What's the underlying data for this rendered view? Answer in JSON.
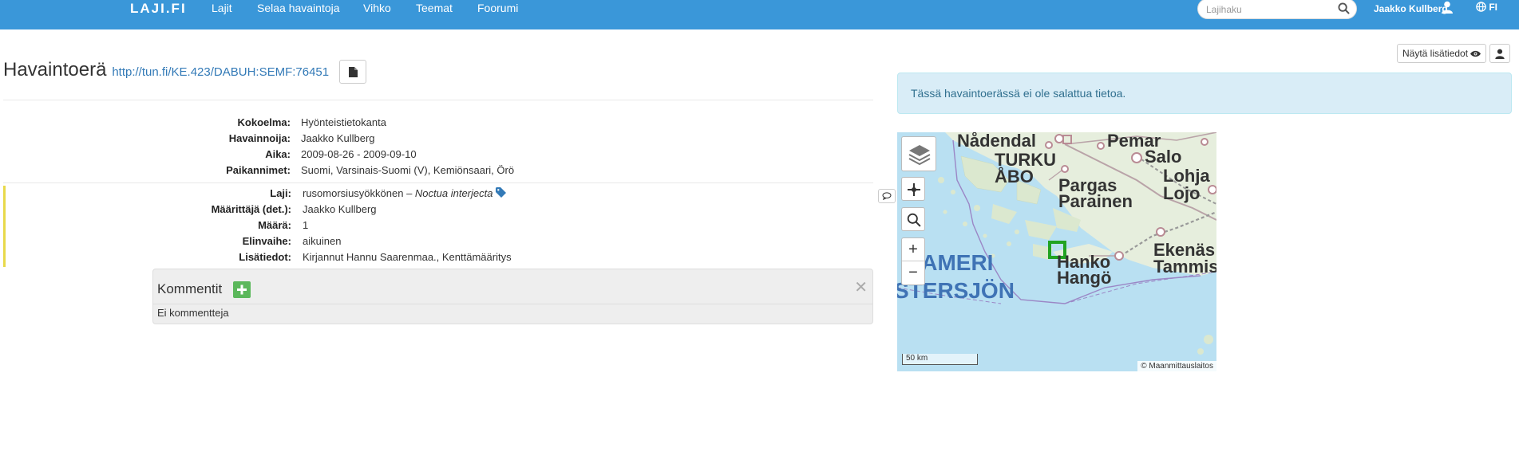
{
  "nav": {
    "brand": "LAJI.FI",
    "links": [
      "Lajit",
      "Selaa havaintoja",
      "Vihko",
      "Teemat",
      "Foorumi"
    ],
    "search_placeholder": "Lajihaku",
    "user": "Jaakko Kullberg",
    "lang": "FI"
  },
  "toolbar": {
    "details_label": "Näytä lisätiedot"
  },
  "page": {
    "title": "Havaintoerä",
    "uri": "http://tun.fi/KE.423/DABUH:SEMF:76451"
  },
  "document": {
    "rows": [
      {
        "label": "Kokoelma:",
        "value": "Hyönteistietokanta"
      },
      {
        "label": "Havainnoija:",
        "value": "Jaakko Kullberg"
      },
      {
        "label": "Aika:",
        "value": "2009-08-26 - 2009-09-10"
      },
      {
        "label": "Paikannimet:",
        "value": "Suomi, Varsinais-Suomi (V), Kemiönsaari, Örö"
      }
    ]
  },
  "unit": {
    "species_label": "Laji:",
    "species_common": "rusomorsiusyökkönen",
    "species_sep": " – ",
    "species_scientific": "Noctua interjecta",
    "rows": [
      {
        "label": "Määrittäjä (det.):",
        "value": "Jaakko Kullberg"
      },
      {
        "label": "Määrä:",
        "value": "1"
      },
      {
        "label": "Elinvaihe:",
        "value": "aikuinen"
      },
      {
        "label": "Lisätiedot:",
        "value": "Kirjannut Hannu Saarenmaa., Kenttämääritys"
      }
    ]
  },
  "comments": {
    "title": "Kommentit",
    "empty": "Ei kommentteja"
  },
  "alert": {
    "text": "Tässä havaintoerässä ei ole salattua tietoa."
  },
  "map": {
    "places": [
      "Nådendal",
      "TURKU",
      "ÅBO",
      "Pemar",
      "Salo",
      "Pargas",
      "Parainen",
      "Lohja",
      "Lojo",
      "Hanko",
      "Hangö",
      "Ekenäs",
      "Tammis"
    ],
    "sea_labels": [
      "HAMERI",
      "STERSJÖN"
    ],
    "scale": "50 km",
    "attribution": "© Maanmittauslaitos",
    "zoom_in": "+",
    "zoom_out": "−",
    "colors": {
      "sea": "#b9e0f2",
      "land": "#e6eedd",
      "marker": "#22a322"
    }
  }
}
